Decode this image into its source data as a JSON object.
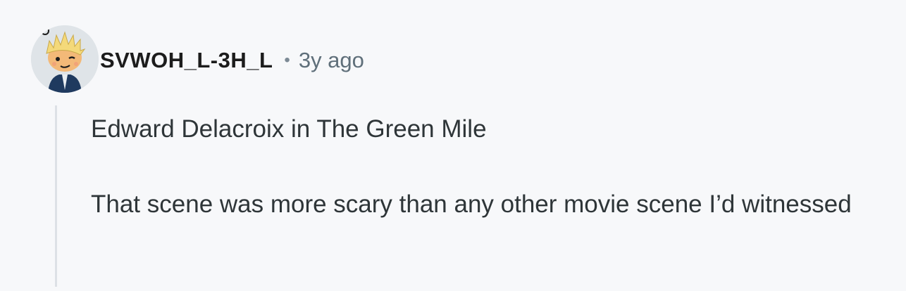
{
  "comment": {
    "author": "SVWOH_L-3H_L",
    "separator": "•",
    "timestamp": "3y ago",
    "paragraphs": [
      "Edward Delacroix in The Green Mile",
      "That scene was more scary than any other movie scene I’d witnessed"
    ]
  },
  "colors": {
    "background": "#f7f8fa",
    "username": "#1c1c1c",
    "timestamp": "#5f6f7a",
    "body_text": "#2e3538",
    "thread_line": "#dde1e6"
  },
  "icons": {
    "avatar": "snoo-avatar-icon"
  }
}
